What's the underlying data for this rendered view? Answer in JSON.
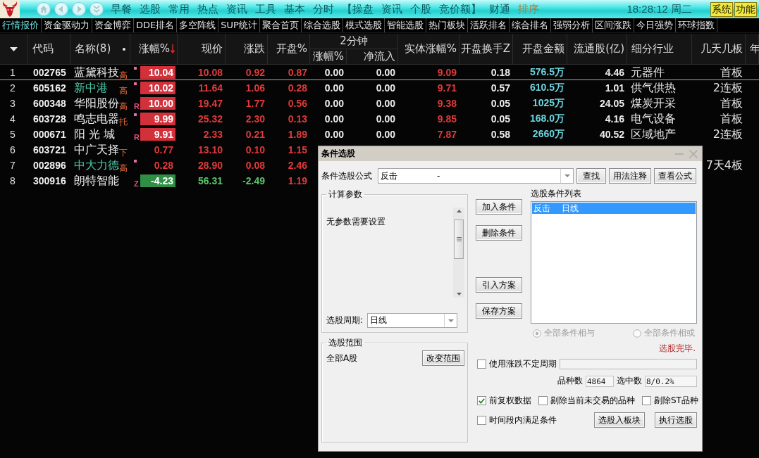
{
  "app_bar": {
    "menu": [
      {
        "label": "早餐",
        "selected": false
      },
      {
        "label": "选股",
        "selected": false
      },
      {
        "label": "常用",
        "selected": false
      },
      {
        "label": "热点",
        "selected": false
      },
      {
        "label": "资讯",
        "selected": false
      },
      {
        "label": "工具",
        "selected": false
      },
      {
        "label": "基本",
        "selected": false
      },
      {
        "label": "分时",
        "selected": false
      },
      {
        "label": "【操盘",
        "selected": false
      },
      {
        "label": "资讯",
        "selected": false
      },
      {
        "label": "个股",
        "selected": false
      },
      {
        "label": "竞价额】",
        "selected": false
      },
      {
        "label": "财通",
        "selected": false
      },
      {
        "label": "排序",
        "selected": true
      }
    ],
    "clock": "18:28:12 周二",
    "buttons": [
      "系统",
      "功能"
    ]
  },
  "tabs": [
    {
      "label": "行情报价",
      "selected": true
    },
    {
      "label": "资金驱动力",
      "selected": false
    },
    {
      "label": "资金博弈",
      "selected": false
    },
    {
      "label": "DDE排名",
      "selected": false
    },
    {
      "label": "多空阵线",
      "selected": false
    },
    {
      "label": "SUP统计",
      "selected": false
    },
    {
      "label": "聚合首页",
      "selected": false
    },
    {
      "label": "综合选股",
      "selected": false
    },
    {
      "label": "模式选股",
      "selected": false
    },
    {
      "label": "智能选股",
      "selected": false
    },
    {
      "label": "热门板块",
      "selected": false
    },
    {
      "label": "活跃排名",
      "selected": false
    },
    {
      "label": "综合排名",
      "selected": false
    },
    {
      "label": "强弱分析",
      "selected": false
    },
    {
      "label": "区间涨跌",
      "selected": false
    },
    {
      "label": "今日强势",
      "selected": false
    },
    {
      "label": "环球指数",
      "selected": false
    }
  ],
  "table": {
    "columns": [
      {
        "label": "代码"
      },
      {
        "label": "名称(8)",
        "dot": true
      },
      {
        "label": "涨幅%",
        "sorted_descending": true
      },
      {
        "label": "现价"
      },
      {
        "label": "涨跌"
      },
      {
        "label": "开盘%"
      },
      {
        "label": "2分钟",
        "children": [
          {
            "label": "涨幅%"
          },
          {
            "label": "净流入"
          }
        ]
      },
      {
        "label": "实体涨幅%"
      },
      {
        "label": "开盘换手Z"
      },
      {
        "label": "开盘金额"
      },
      {
        "label": "流通股(亿)"
      },
      {
        "label": "细分行业"
      },
      {
        "label": "几天几板"
      },
      {
        "label": "年"
      }
    ],
    "rows": [
      {
        "index": "1",
        "code": "002765",
        "name": "蓝黛科技",
        "name_highlight": false,
        "tag": "高",
        "flag": {
          "kind": "dot"
        },
        "rising": true,
        "change_highlight": true,
        "change": "10.04",
        "price": "10.08",
        "delta": "0.92",
        "open_pct": "0.87",
        "min2_change": "0.00",
        "min2_inflow": "0.00",
        "body_change": "9.09",
        "open_turnover": "0.18",
        "open_amount": "576.5万",
        "float_shares": "4.46",
        "industry": "元器件",
        "streak": "首板",
        "selected": true
      },
      {
        "index": "2",
        "code": "605162",
        "name": "新中港",
        "name_highlight": true,
        "tag": "高",
        "flag": {
          "kind": "dot"
        },
        "rising": true,
        "change_highlight": true,
        "change": "10.02",
        "price": "11.64",
        "delta": "1.06",
        "open_pct": "0.28",
        "min2_change": "0.00",
        "min2_inflow": "0.00",
        "body_change": "9.71",
        "open_turnover": "0.57",
        "open_amount": "610.5万",
        "float_shares": "1.01",
        "industry": "供气供热",
        "streak": "2连板",
        "selected": false
      },
      {
        "index": "3",
        "code": "600348",
        "name": "华阳股份",
        "name_highlight": false,
        "tag": "高",
        "flag": {
          "kind": "letter",
          "text": "R"
        },
        "rising": true,
        "change_highlight": true,
        "change": "10.00",
        "price": "19.47",
        "delta": "1.77",
        "open_pct": "0.56",
        "min2_change": "0.00",
        "min2_inflow": "0.00",
        "body_change": "9.38",
        "open_turnover": "0.05",
        "open_amount": "1025万",
        "float_shares": "24.05",
        "industry": "煤炭开采",
        "streak": "首板",
        "selected": false
      },
      {
        "index": "4",
        "code": "603728",
        "name": "鸣志电器",
        "name_highlight": false,
        "tag": "托",
        "flag": {
          "kind": "dot"
        },
        "rising": true,
        "change_highlight": true,
        "change": "9.99",
        "price": "25.32",
        "delta": "2.30",
        "open_pct": "0.13",
        "min2_change": "0.00",
        "min2_inflow": "0.00",
        "body_change": "9.85",
        "open_turnover": "0.05",
        "open_amount": "168.0万",
        "float_shares": "4.16",
        "industry": "电气设备",
        "streak": "首板",
        "selected": false
      },
      {
        "index": "5",
        "code": "000671",
        "name": "阳 光 城",
        "name_highlight": false,
        "flag": {
          "kind": "letter",
          "text": "R"
        },
        "rising": true,
        "change_highlight": true,
        "change": "9.91",
        "price": "2.33",
        "delta": "0.21",
        "open_pct": "1.89",
        "min2_change": "0.00",
        "min2_inflow": "0.00",
        "body_change": "7.87",
        "open_turnover": "0.58",
        "open_amount": "2660万",
        "float_shares": "40.52",
        "industry": "区域地产",
        "streak": "2连板",
        "selected": false
      },
      {
        "index": "6",
        "code": "603721",
        "name": "中广天择",
        "name_highlight": false,
        "tag": "下",
        "rising": true,
        "change_highlight": false,
        "change": "0.77",
        "price": "13.10",
        "delta": "0.10",
        "open_pct": "1.15",
        "selected": false
      },
      {
        "index": "7",
        "code": "002896",
        "name": "中大力德",
        "name_highlight": true,
        "tag": "高",
        "flag": {
          "kind": "dot"
        },
        "rising": true,
        "change_highlight": false,
        "change": "0.28",
        "price": "28.90",
        "delta": "0.08",
        "open_pct": "2.46",
        "streak": "7天4板",
        "selected": false
      },
      {
        "index": "8",
        "code": "300916",
        "name": "朗特智能",
        "name_highlight": false,
        "flag": {
          "kind": "letter",
          "text": "Z"
        },
        "rising": false,
        "change_highlight": true,
        "change": "-4.23",
        "price": "56.31",
        "delta": "-2.49",
        "open_pct": "1.19",
        "selected": false
      }
    ]
  },
  "dialog": {
    "title": "条件选股",
    "formula": {
      "label": "条件选股公式",
      "value": "反击",
      "note": "-"
    },
    "formula_buttons": [
      "查找",
      "用法注释",
      "查看公式"
    ],
    "params": {
      "title": "计算参数",
      "message": "无参数需要设置",
      "period_label": "选股周期:",
      "period": "日线"
    },
    "scope": {
      "title": "选股范围",
      "value": "全部A股",
      "button": "改变范围"
    },
    "action_buttons": [
      "加入条件",
      "删除条件",
      "引入方案",
      "保存方案"
    ],
    "conditions": {
      "title": "选股条件列表",
      "items": [
        {
          "name": "反击",
          "period": "日线",
          "selected": true
        }
      ]
    },
    "logic": [
      {
        "label": "全部条件相与",
        "selected": true,
        "disabled": true
      },
      {
        "label": "全部条件相或",
        "selected": false,
        "disabled": true
      }
    ],
    "status": "选股完毕.",
    "variable_period": {
      "label": "使用涨跌不定周期",
      "checked": false
    },
    "progress": {
      "level": 0
    },
    "counts": [
      {
        "label": "品种数",
        "value": "4864"
      },
      {
        "label": "选中数",
        "value": "8/0.2%"
      }
    ],
    "options": [
      {
        "label": "前复权数据",
        "checked": true
      },
      {
        "label": "剔除当前未交易的品种",
        "checked": false
      },
      {
        "label": "剔除ST品种",
        "checked": false
      }
    ],
    "time_option": {
      "label": "时间段内满足条件",
      "checked": false
    },
    "run_buttons": [
      "选股入板块",
      "执行选股"
    ]
  }
}
